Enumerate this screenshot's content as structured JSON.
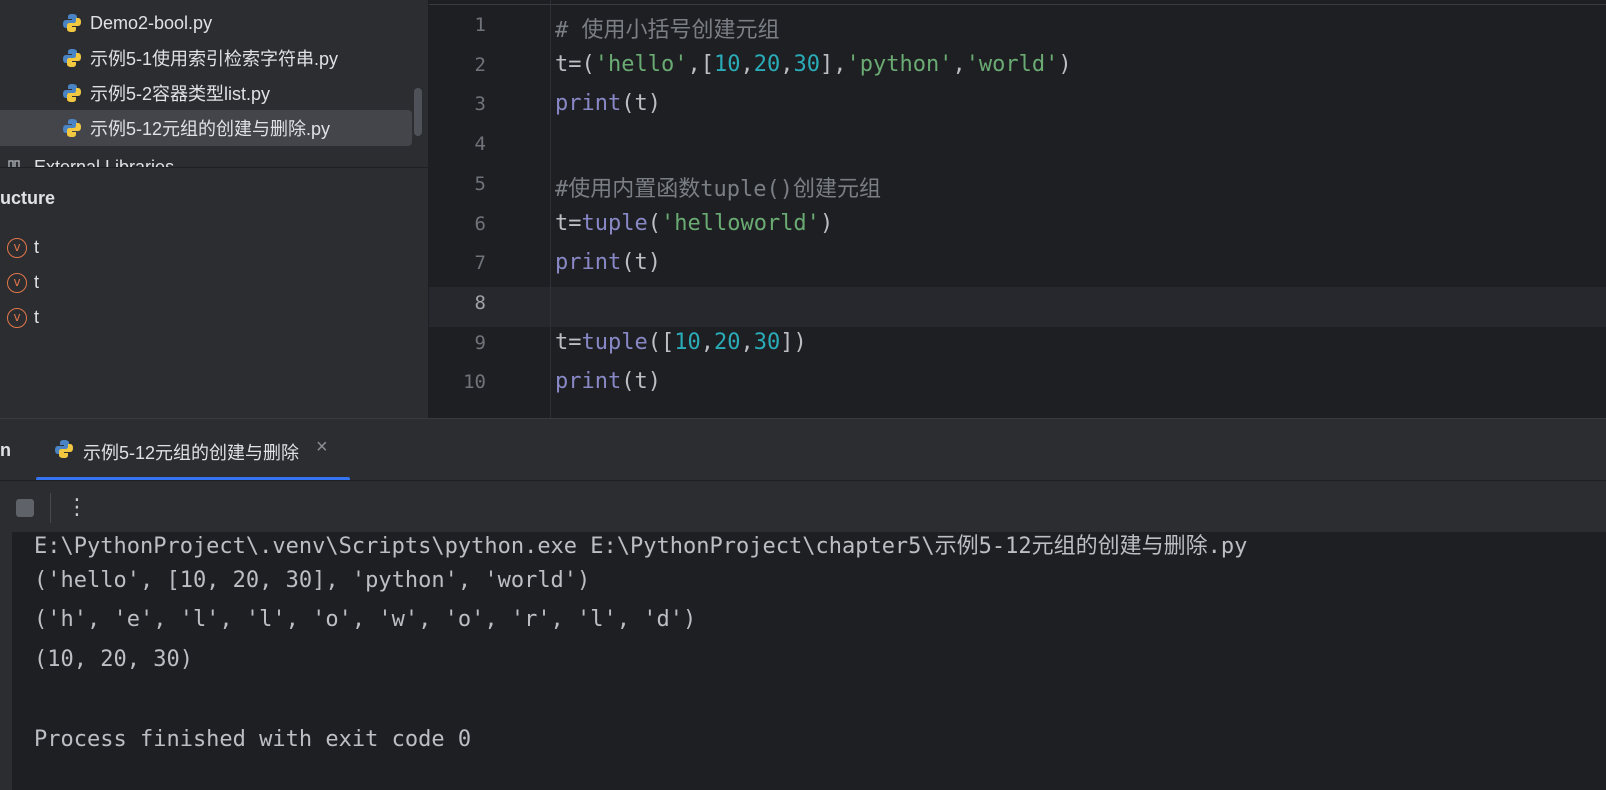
{
  "project_tree": {
    "files": [
      {
        "name": "Demo2-bool.py",
        "icon": "python-file-icon"
      },
      {
        "name": "示例5-1使用索引检索字符串.py",
        "icon": "python-file-icon"
      },
      {
        "name": "示例5-2容器类型list.py",
        "icon": "python-file-icon"
      },
      {
        "name": "示例5-12元组的创建与删除.py",
        "icon": "python-file-icon",
        "selected": true
      }
    ],
    "external_libraries": "External Libraries"
  },
  "structure": {
    "title": "ucture",
    "items": [
      {
        "label": "t",
        "icon": "variable-icon",
        "badge": "v"
      },
      {
        "label": "t",
        "icon": "variable-icon",
        "badge": "v"
      },
      {
        "label": "t",
        "icon": "variable-icon",
        "badge": "v"
      }
    ]
  },
  "editor": {
    "current_line": 8,
    "lines": [
      {
        "num": "1",
        "tokens": [
          {
            "t": "# 使用小括号创建元组",
            "c": "com"
          }
        ]
      },
      {
        "num": "2",
        "tokens": [
          {
            "t": "t=(",
            "c": ""
          },
          {
            "t": "'hello'",
            "c": "str"
          },
          {
            "t": ",[",
            "c": ""
          },
          {
            "t": "10",
            "c": "num"
          },
          {
            "t": ",",
            "c": ""
          },
          {
            "t": "20",
            "c": "num"
          },
          {
            "t": ",",
            "c": ""
          },
          {
            "t": "30",
            "c": "num"
          },
          {
            "t": "],",
            "c": ""
          },
          {
            "t": "'python'",
            "c": "str"
          },
          {
            "t": ",",
            "c": ""
          },
          {
            "t": "'world'",
            "c": "str"
          },
          {
            "t": ")",
            "c": ""
          }
        ]
      },
      {
        "num": "3",
        "tokens": [
          {
            "t": "print",
            "c": "fn"
          },
          {
            "t": "(t)",
            "c": ""
          }
        ]
      },
      {
        "num": "4",
        "tokens": []
      },
      {
        "num": "5",
        "tokens": [
          {
            "t": "#使用内置函数tuple()创建元组",
            "c": "com"
          }
        ]
      },
      {
        "num": "6",
        "tokens": [
          {
            "t": "t=",
            "c": ""
          },
          {
            "t": "tuple",
            "c": "fn"
          },
          {
            "t": "(",
            "c": ""
          },
          {
            "t": "'helloworld'",
            "c": "str"
          },
          {
            "t": ")",
            "c": ""
          }
        ]
      },
      {
        "num": "7",
        "tokens": [
          {
            "t": "print",
            "c": "fn"
          },
          {
            "t": "(t)",
            "c": ""
          }
        ]
      },
      {
        "num": "8",
        "tokens": []
      },
      {
        "num": "9",
        "tokens": [
          {
            "t": "t=",
            "c": ""
          },
          {
            "t": "tuple",
            "c": "fn"
          },
          {
            "t": "([",
            "c": ""
          },
          {
            "t": "10",
            "c": "num"
          },
          {
            "t": ",",
            "c": ""
          },
          {
            "t": "20",
            "c": "num"
          },
          {
            "t": ",",
            "c": ""
          },
          {
            "t": "30",
            "c": "num"
          },
          {
            "t": "])",
            "c": ""
          }
        ]
      },
      {
        "num": "10",
        "tokens": [
          {
            "t": "print",
            "c": "fn"
          },
          {
            "t": "(t)",
            "c": ""
          }
        ]
      }
    ]
  },
  "run_panel": {
    "label": "n",
    "tab_label": "示例5-12元组的创建与删除",
    "close_glyph": "×",
    "more_glyph": "⋮",
    "accent": "#3574f0"
  },
  "console": {
    "lines": [
      "E:\\PythonProject\\.venv\\Scripts\\python.exe E:\\PythonProject\\chapter5\\示例5-12元组的创建与删除.py",
      "('hello', [10, 20, 30], 'python', 'world')",
      "('h', 'e', 'l', 'l', 'o', 'w', 'o', 'r', 'l', 'd')",
      "(10, 20, 30)",
      "",
      "Process finished with exit code 0"
    ]
  }
}
